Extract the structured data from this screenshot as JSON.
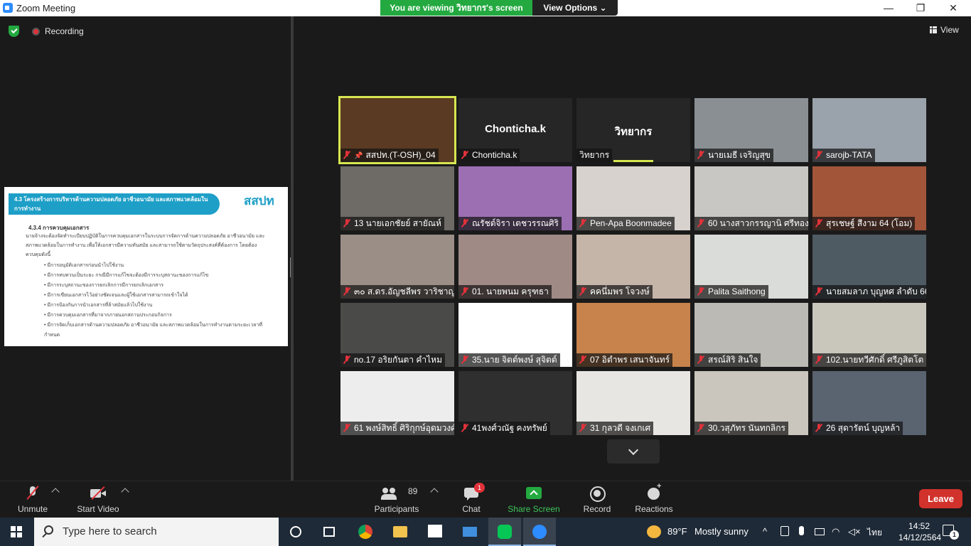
{
  "window": {
    "title": "Zoom Meeting",
    "viewing_banner": "You are viewing วิทยากร's screen",
    "view_options": "View Options"
  },
  "share": {
    "recording_label": "Recording",
    "slide": {
      "heading": "4.3 โครงสร้างการบริหารด้านความปลอดภัย อาชีวอนามัย และสภาพแวดล้อมในการทำงาน",
      "logo": "สสปท",
      "subheading": "4.3.4 การควบคุมเอกสาร",
      "paragraph": "นายจ้างจะต้องจัดทำระเบียบปฏิบัติในการควบคุมเอกสารในระบบการจัดการด้านความปลอดภัย อาชีวอนามัย และสภาพแวดล้อมในการทำงาน เพื่อให้เอกสารมีความทันสมัย และสามารถใช้ตามวัตถุประสงค์ที่ต้องการ โดยต้องควบคุมดังนี้",
      "bullets": [
        "มีการอนุมัติเอกสารก่อนนำไปใช้งาน",
        "มีการทบทวนเป็นระยะ กรณีมีการแก้ไขจะต้องมีการระบุสถานะของการแก้ไข",
        "มีการระบุสถานะของการยกเลิกการมีการยกเลิกเอกสาร",
        "มีการเขียนเอกสารไว้อย่างชัดเจนและผู้ใช้เอกสารสามารถเข้าใจได้",
        "มีการป้องกันการนำเอกสารที่ล้าสมัยแล้วไปใช้งาน",
        "มีการควบคุมเอกสารที่มาจากภายนอกสถานประกอบกิจการ",
        "มีการจัดเก็บเอกสารด้านความปลอดภัย อาชีวอนามัย และสภาพแวดล้อมในการทำงานตามระยะเวลาที่กำหนด"
      ]
    }
  },
  "gallery": {
    "view_label": "View",
    "tiles": [
      {
        "name": "สสปท.(T-OSH)_04",
        "bg": "#5a3a22",
        "pinned": true,
        "active": true
      },
      {
        "name": "Chonticha.k",
        "bg": "#262626",
        "big": "Chonticha.k"
      },
      {
        "name": "วิทยากร",
        "bg": "#262626",
        "big": "วิทยากร",
        "speaking": true,
        "no_mute": true
      },
      {
        "name": "นายเมธี  เจริญสุข",
        "bg": "#8a8f93"
      },
      {
        "name": "sarojb-TATA",
        "bg": "#9aa3ab"
      },
      {
        "name": "13 นายเอกชัยย์ สายัณห์",
        "bg": "#6e6a66"
      },
      {
        "name": "ณรัชต์จิรา เตชวรรณศิริ",
        "bg": "#9c6fb3"
      },
      {
        "name": "Pen-Apa Boonmadee",
        "bg": "#d7d2ce"
      },
      {
        "name": "60 นางสาวกรรญานิ  ศรีทอง",
        "bg": "#c9c7c3"
      },
      {
        "name": "สุรเชษฐ์  สีงาม 64 (โอม)",
        "bg": "#a3553a"
      },
      {
        "name": "๓๐ ส.ดร.อัญชลีพร วาริชาญการ",
        "bg": "#9b8e86"
      },
      {
        "name": "01. นายพนม ครุฑธา",
        "bg": "#a08a86"
      },
      {
        "name": "คคนึ่มพร  โจวงษ์",
        "bg": "#c5b5a8"
      },
      {
        "name": "Palita Saithong",
        "bg": "#d9dcd8"
      },
      {
        "name": "นายสมลาภ บุญหศ ลำดับ 66",
        "bg": "#4f5b63"
      },
      {
        "name": "no.17 อริยกันตา คำไหม",
        "bg": "#4a4a48"
      },
      {
        "name": "35.นาย จิตต์พงษ์ สุจิตต์",
        "bg": "#ffffff"
      },
      {
        "name": "07 อิตำพร  เสนาจันทร์",
        "bg": "#c7834b"
      },
      {
        "name": "สรณ์สิริ สินใจ",
        "bg": "#bcbab4"
      },
      {
        "name": "102.นายทวีศักดิ์  ศรีภูสิตโต",
        "bg": "#c9c6bc"
      },
      {
        "name": "61 พงษ์สิทธิ์ ศิริกุกษ์อุดมวงศ์",
        "bg": "#ededed"
      },
      {
        "name": "41พงศ์วณัฐ  คงทรัพย์",
        "bg": "#2f2f2f"
      },
      {
        "name": "31 กุลวดี จงเกเศ",
        "bg": "#e8e6e3"
      },
      {
        "name": "30.วสุภัทร นันทกลิกร",
        "bg": "#cac6bd"
      },
      {
        "name": "26 สุดารัตน์ บุญหล้า",
        "bg": "#5a6370"
      }
    ]
  },
  "controls": {
    "unmute": "Unmute",
    "start_video": "Start Video",
    "participants": "Participants",
    "participants_count": "89",
    "chat": "Chat",
    "chat_badge": "1",
    "share_screen": "Share Screen",
    "record": "Record",
    "reactions": "Reactions",
    "leave": "Leave"
  },
  "taskbar": {
    "search_placeholder": "Type here to search",
    "weather_temp": "89°F",
    "weather_desc": "Mostly sunny",
    "lang": "ไทย",
    "time": "14:52",
    "date": "14/12/2564",
    "notif_count": "1"
  },
  "colors": {
    "accent_green": "#23a940",
    "leave_red": "#d2322c",
    "active_border": "#d6e651",
    "taskbar": "#1e2a38"
  }
}
